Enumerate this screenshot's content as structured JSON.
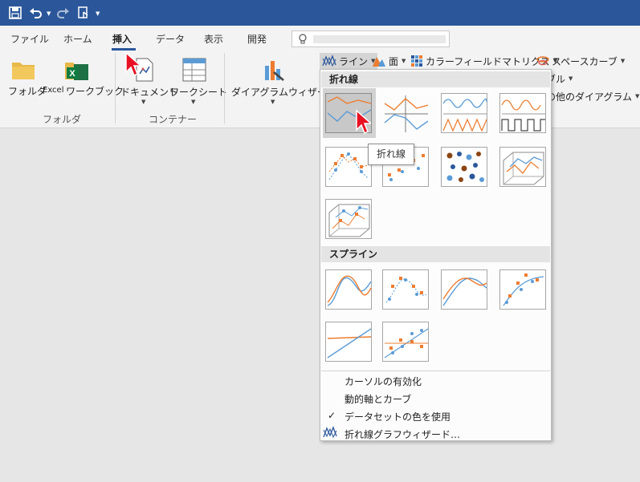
{
  "ribbon_tabs": [
    "ファイル",
    "ホーム",
    "挿入",
    "データ",
    "表示",
    "開発"
  ],
  "active_tab": "挿入",
  "groups": {
    "folder": {
      "label": "フォルダ",
      "buttons": {
        "folder": "フォルダ",
        "excel_workbook_prefix": "Excel",
        "excel_workbook": "ワークブック"
      }
    },
    "container": {
      "label": "コンテナー",
      "buttons": {
        "document": "ドキュメント",
        "worksheet": "ワークシート"
      }
    },
    "diagram": {
      "wizard": "ダイアグラムウィザード",
      "line": "ライン",
      "surface": "面",
      "color_field_matrix": "カラーフィールドマトリクス",
      "space_curve": "スペースカーブ",
      "bubble": "バブル",
      "other": "その他のダイアグラム"
    }
  },
  "menu": {
    "sections": [
      {
        "title": "折れ線"
      },
      {
        "title": "スプライン"
      }
    ],
    "items": [
      {
        "label": "カーソルの有効化",
        "checked": false
      },
      {
        "label": "動的軸とカーブ",
        "checked": false
      },
      {
        "label": "データセットの色を使用",
        "checked": true
      },
      {
        "label": "折れ線グラフウィザード…",
        "checked": false
      }
    ],
    "check_mark": "✓"
  },
  "tooltip": "折れ線",
  "icons": {
    "save": "save-icon",
    "undo": "undo-icon",
    "redo": "redo-icon",
    "touch": "touch-mode-icon",
    "search": "lightbulb-icon"
  },
  "colors": {
    "titlebar": "#2b579a",
    "accent_underline": "#2b579a",
    "chart_orange": "#ed7d31",
    "chart_blue": "#5b9bd5",
    "cursor_red": "#e81123"
  }
}
